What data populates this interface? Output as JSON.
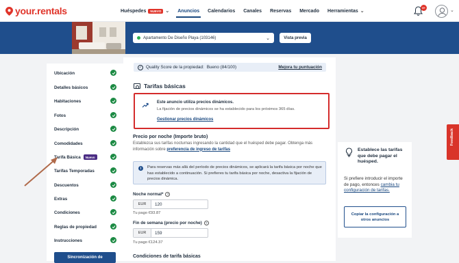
{
  "brand": {
    "name": "your.rentals",
    "accent": "#e0342a",
    "primary": "#1f4e8c"
  },
  "nav": {
    "items": [
      {
        "label": "Huéspedes",
        "badge": "NUEVO",
        "has_dropdown": true
      },
      {
        "label": "Anuncios",
        "active": true
      },
      {
        "label": "Calendarios"
      },
      {
        "label": "Canales"
      },
      {
        "label": "Reservas"
      },
      {
        "label": "Mercado"
      },
      {
        "label": "Herramientas",
        "has_dropdown": true
      }
    ],
    "notifications_count": "9+"
  },
  "property": {
    "name": "Apartamento De Diseño Playa (103146)",
    "preview_label": "Vista previa"
  },
  "quality": {
    "label": "Quality Score de la propiedad:",
    "value": "Bueno (84/100)",
    "link": "Mejora tu puntuación"
  },
  "sidebar": {
    "items": [
      {
        "label": "Ubicación"
      },
      {
        "label": "Detalles básicos"
      },
      {
        "label": "Habitaciones"
      },
      {
        "label": "Fotos"
      },
      {
        "label": "Descripción"
      },
      {
        "label": "Comodidades"
      },
      {
        "label": "Tarifa Básica",
        "badge": "Nuevo",
        "active": true
      },
      {
        "label": "Tarifas Temporadas"
      },
      {
        "label": "Descuentos"
      },
      {
        "label": "Extras"
      },
      {
        "label": "Condiciones"
      },
      {
        "label": "Reglas de propiedad"
      },
      {
        "label": "Instrucciones"
      }
    ],
    "sync_button": "Sincronización de"
  },
  "main": {
    "title": "Tarifas básicas",
    "dynamic": {
      "title": "Este anuncio utiliza precios dinámicos.",
      "subtitle": "La fijación de precios dinámicos se ha establecido para los próximos 365 días.",
      "link": "Gestionar precios dinámicos"
    },
    "price_heading": "Precio por noche (Importe bruto)",
    "price_desc": "Establezca sus tarifas nocturnas ingresando la cantidad que el huésped debe pagar. Obtenga más información sobre ",
    "price_desc_link": "preferencia de ingreso de tarifas",
    "info": "Para reservas más allá del período de precios dinámicos, se aplicará la tarifa básica por noche que has establecido a continuación. Si prefieres tu tarifa básica por noche, desactiva la fijación de precios dinámica.",
    "night": {
      "label": "Noche normal*",
      "currency": "EUR",
      "value": "120",
      "hint": "Tu pago €93.87"
    },
    "weekend": {
      "label": "Fin de semana (precio por noche)",
      "currency": "EUR",
      "value": "159",
      "hint": "Tu pago €124.37"
    },
    "conditions_heading": "Condiciones de tarifa básicas"
  },
  "right_card": {
    "title": "Establece las tarifas que debe pagar el huésped.",
    "text": "Si prefiere introducir el importe de pago, entonces ",
    "text_link": "cambia tu configuración de tarifas.",
    "button": "Copiar la configuración a otros anuncios"
  },
  "feedback": {
    "label": "Feedback"
  }
}
